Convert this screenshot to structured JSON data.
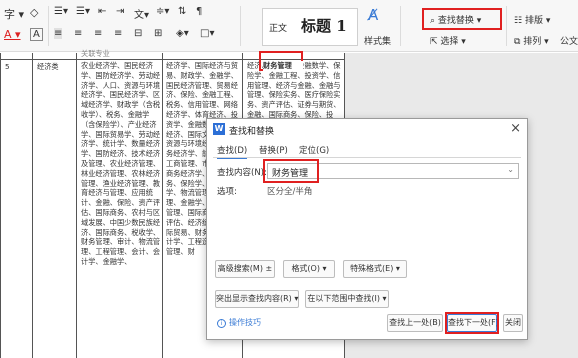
{
  "ribbon": {
    "style_normal": "正文",
    "style_heading": "标题 1",
    "styles_set": "样式集",
    "find_replace": "查找替换",
    "select": "选择",
    "layout": "排版",
    "arrange": "排列",
    "formula": "公文格",
    "colors": {
      "accent": "#3a7bd5",
      "highlight": "#e02020"
    }
  },
  "table": {
    "row_num": "5",
    "major": "经济类",
    "header_cell": "财务管理",
    "col3_text": "农业经济学、国民经济学、国防经济学、劳动经济学、人口、资源与环境经济学、国民经济学、区域经济学、财政学（含税收学）、税务、金融学（含保险学）、产业经济学、国际贸易学、劳动经济学、统计学、数量经济学、国防经济、技术经济及管理、农业经济管理、林业经济管理、农林经济管理、渔业经济管理、教育经济与管理、应用统计、金融、保险、资产评估、国际商务、农村与区域发展、中国少数民族经济、国际商务、税收学、财务管理、审计、物流管理、工程管理、会计、会计学、金融学、",
    "col4_text": "经济学、国际经济与贸易、财政学、金融学、国民经济管理、贸易经济、保险、金融工程、税务、信用管理、网络经济学、体育经济、投资学、金融数学、海洋经济、国际文化贸易、资源与环境经济学、商务经济学、能源经济、工商管理、市场营销、商务经济学、电子商务、保险学、金融数学、物流管理、信用管理、金融学、农林经济管理、国际商务、资产评估、经济统计学、国际贸易、财务管理、审计学、工程造价、工程管理、财",
    "col5_text": "经济、金融学、金融数学、保险学、金融工程、投资学、信用管理、经济与金融、金融与管理、保险实务、医疗保险实务、资产评估、证券与期货、金融、国际商务、保险、投资、经济学、贸易、电子商务、",
    "partial_header": "关联专业",
    "plus": "+"
  },
  "dialog": {
    "title": "查找和替换",
    "tabs": [
      "查找(D)",
      "替换(P)",
      "定位(G)"
    ],
    "find_label": "查找内容(N):",
    "find_value": "财务管理",
    "options_label": "选项:",
    "options_value": "区分全/半角",
    "btn_advanced": "高级搜索(M) ±",
    "btn_format": "格式(O) ▾",
    "btn_special": "特殊格式(E) ▾",
    "btn_highlight": "突出显示查找内容(R) ▾",
    "btn_find_in": "在以下范围中查找(I) ▾",
    "tips": "操作技巧",
    "btn_find_prev": "查找上一处(B)",
    "btn_find_next": "查找下一处(F)",
    "btn_close": "关闭",
    "close_glyph": "×",
    "dropdown_glyph": "⌄"
  }
}
